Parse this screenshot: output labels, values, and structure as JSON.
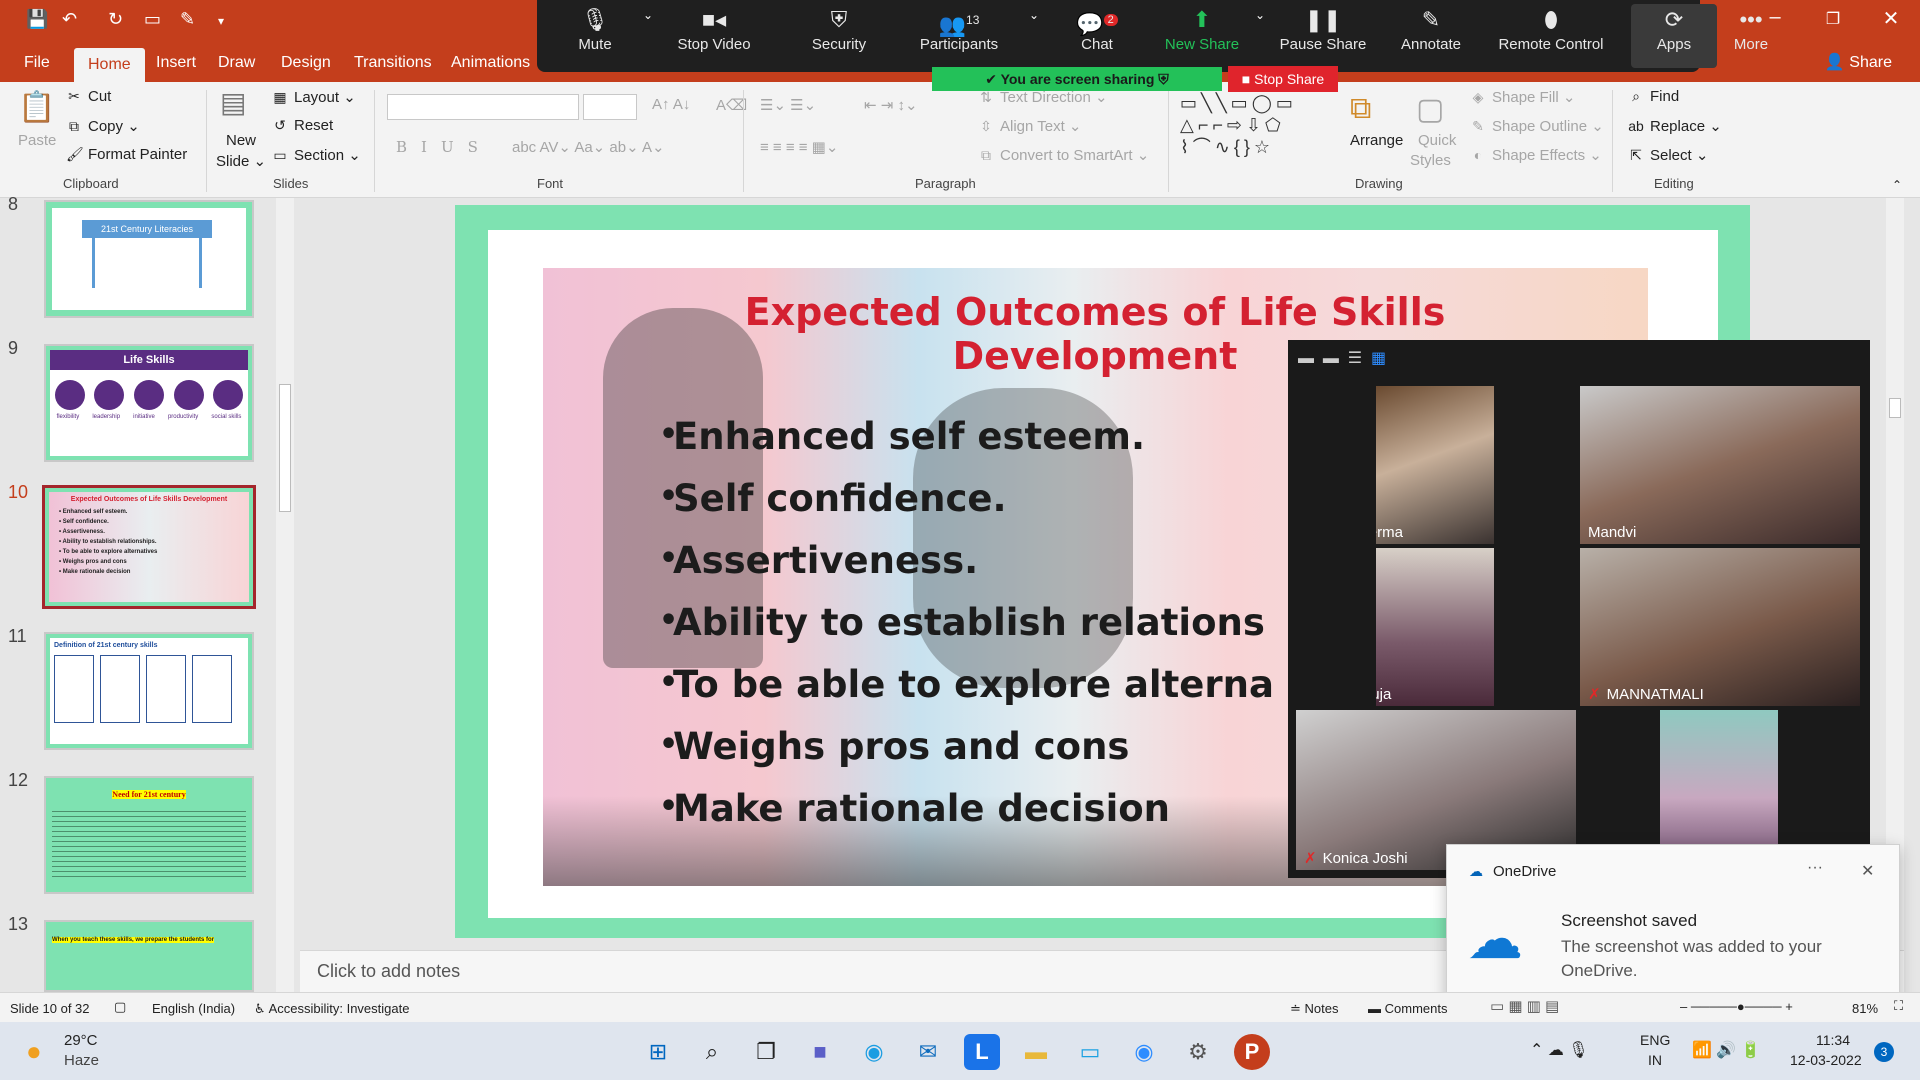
{
  "quick_access": {
    "save": "💾",
    "undo": "↶",
    "redo": "↻"
  },
  "tabs": [
    "File",
    "Home",
    "Insert",
    "Draw",
    "Design",
    "Transitions",
    "Animations"
  ],
  "share_label": "Share",
  "ribbon": {
    "clipboard": {
      "paste": "Paste",
      "cut": "Cut",
      "copy": "Copy",
      "format_painter": "Format Painter",
      "group": "Clipboard"
    },
    "slides": {
      "new_slide_1": "New",
      "new_slide_2": "Slide",
      "layout": "Layout",
      "reset": "Reset",
      "section": "Section",
      "group": "Slides"
    },
    "font": {
      "group": "Font"
    },
    "paragraph": {
      "text_direction": "Text Direction",
      "align_text": "Align Text",
      "convert_smartart": "Convert to SmartArt",
      "group": "Paragraph"
    },
    "drawing": {
      "arrange": "Arrange",
      "quick_styles_1": "Quick",
      "quick_styles_2": "Styles",
      "shape_fill": "Shape Fill",
      "shape_outline": "Shape Outline",
      "shape_effects": "Shape Effects",
      "group": "Drawing"
    },
    "editing": {
      "find": "Find",
      "replace": "Replace",
      "select": "Select",
      "group": "Editing"
    }
  },
  "zoom": {
    "mute": "Mute",
    "stop_video": "Stop Video",
    "security": "Security",
    "participants": "Participants",
    "participants_count": "13",
    "chat": "Chat",
    "chat_badge": "2",
    "new_share": "New Share",
    "pause_share": "Pause Share",
    "annotate": "Annotate",
    "remote_control": "Remote Control",
    "apps": "Apps",
    "more": "More",
    "sharing_banner": "You are screen sharing",
    "stop_share": "Stop Share"
  },
  "thumbnails": [
    {
      "num": "8",
      "title": "21st Century Literacies"
    },
    {
      "num": "9",
      "title": "Life Skills",
      "labels": [
        "flexibility",
        "leadership",
        "initiative",
        "productivity",
        "social skills"
      ]
    },
    {
      "num": "10",
      "title": "Expected Outcomes of Life Skills Development"
    },
    {
      "num": "11",
      "title": "Definition of 21st century skills"
    },
    {
      "num": "12",
      "title": "Need for 21st century"
    },
    {
      "num": "13",
      "title": "When you teach these skills, we prepare the students for"
    }
  ],
  "slide": {
    "title_line1": "Expected Outcomes of Life Skills",
    "title_line2": "Development",
    "bullets": [
      "Enhanced self esteem.",
      "Self confidence.",
      "Assertiveness.",
      "Ability to establish relations",
      "To be able to explore alterna",
      "Weighs pros and cons",
      "Make rationale decision"
    ]
  },
  "notes_placeholder": "Click to add notes",
  "participants": [
    "Veena verma",
    "Mandvi",
    "Neha ahuja",
    "MANNATMALI",
    "Konica Joshi"
  ],
  "onedrive": {
    "app": "OneDrive",
    "title": "Screenshot saved",
    "body": "The screenshot was added to your OneDrive.",
    "more": "···",
    "close": "✕"
  },
  "statusbar": {
    "slide": "Slide 10 of 32",
    "language": "English (India)",
    "accessibility": "Accessibility: Investigate",
    "notes": "Notes",
    "comments": "Comments",
    "zoom": "81%"
  },
  "taskbar": {
    "temp": "29°C",
    "weather": "Haze",
    "lang1": "ENG",
    "lang2": "IN",
    "time": "11:34",
    "date": "12-03-2022",
    "notif": "3"
  }
}
